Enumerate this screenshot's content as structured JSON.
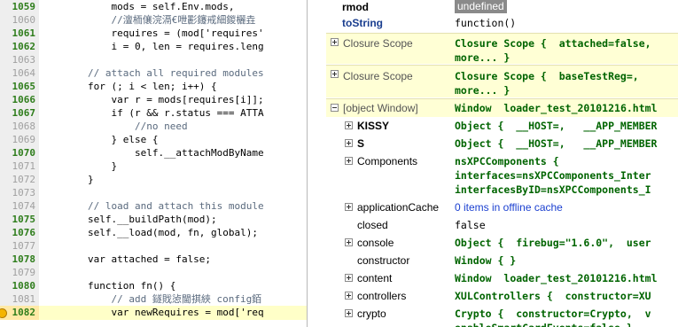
{
  "source": {
    "lines": [
      {
        "num": "1059",
        "exec": true,
        "text": "            mods = self.Env.mods,",
        "comment": false
      },
      {
        "num": "1060",
        "exec": false,
        "text": "            //澶栭儴浣滆€呭彲鑳戒細鍐欐垚",
        "comment": true
      },
      {
        "num": "1061",
        "exec": true,
        "text": "            requires = (mod['requires'",
        "comment": false
      },
      {
        "num": "1062",
        "exec": true,
        "text": "            i = 0, len = requires.leng",
        "comment": false
      },
      {
        "num": "1063",
        "exec": false,
        "text": "",
        "comment": false
      },
      {
        "num": "1064",
        "exec": false,
        "text": "        // attach all required modules",
        "comment": true
      },
      {
        "num": "1065",
        "exec": true,
        "text": "        for (; i < len; i++) {",
        "comment": false
      },
      {
        "num": "1066",
        "exec": true,
        "text": "            var r = mods[requires[i]];",
        "comment": false
      },
      {
        "num": "1067",
        "exec": true,
        "text": "            if (r && r.status === ATTA",
        "comment": false
      },
      {
        "num": "1068",
        "exec": false,
        "text": "                //no need",
        "comment": true
      },
      {
        "num": "1069",
        "exec": false,
        "text": "            } else {",
        "comment": false
      },
      {
        "num": "1070",
        "exec": true,
        "text": "                self.__attachModByName",
        "comment": false
      },
      {
        "num": "1071",
        "exec": false,
        "text": "            }",
        "comment": false
      },
      {
        "num": "1072",
        "exec": false,
        "text": "        }",
        "comment": false
      },
      {
        "num": "1073",
        "exec": false,
        "text": "",
        "comment": false
      },
      {
        "num": "1074",
        "exec": false,
        "text": "        // load and attach this module",
        "comment": true
      },
      {
        "num": "1075",
        "exec": true,
        "text": "        self.__buildPath(mod);",
        "comment": false
      },
      {
        "num": "1076",
        "exec": true,
        "text": "        self.__load(mod, fn, global);",
        "comment": false
      },
      {
        "num": "1077",
        "exec": false,
        "text": "",
        "comment": false
      },
      {
        "num": "1078",
        "exec": true,
        "text": "        var attached = false;",
        "comment": false
      },
      {
        "num": "1079",
        "exec": false,
        "text": "",
        "comment": false
      },
      {
        "num": "1080",
        "exec": true,
        "text": "        function fn() {",
        "comment": false
      },
      {
        "num": "1081",
        "exec": false,
        "text": "            // add 鐩戝惉閫掑綊 config銆",
        "comment": true
      },
      {
        "num": "1082",
        "exec": true,
        "text": "            var newRequires = mod['req",
        "comment": false,
        "current": true
      }
    ]
  },
  "watch": {
    "rmod": {
      "name": "rmod",
      "value": "undefined"
    },
    "toString": {
      "name": "toString",
      "value": "function()"
    },
    "closure1": {
      "label": "Closure Scope",
      "line1": "Closure Scope {  attached=false,",
      "line2": "more... }"
    },
    "closure2": {
      "label": "Closure Scope",
      "line1": "Closure Scope {  baseTestReg=,",
      "line2": "more... }"
    },
    "window": {
      "label": "[object Window]",
      "type": "Window",
      "file": "loader_test_20101216.html"
    },
    "props": [
      {
        "name": "KISSY",
        "style": "bold",
        "twisty": true,
        "value": "Object {  __HOST=,   __APP_MEMBER",
        "kind": "obj"
      },
      {
        "name": "S",
        "style": "bold",
        "twisty": true,
        "value": "Object {  __HOST=,   __APP_MEMBER",
        "kind": "obj"
      },
      {
        "name": "Components",
        "style": "normal",
        "twisty": true,
        "value": "nsXPCComponents {",
        "kind": "obj",
        "extra": [
          "interfaces=nsXPCComponents_Inter",
          "interfacesByID=nsXPCComponents_I"
        ]
      },
      {
        "name": "applicationCache",
        "style": "normal",
        "twisty": true,
        "value": "0 items in offline cache",
        "kind": "link"
      },
      {
        "name": "closed",
        "style": "normal",
        "twisty": false,
        "value": "false",
        "kind": "num"
      },
      {
        "name": "console",
        "style": "normal",
        "twisty": true,
        "value": "Object {  firebug=",
        "kind": "obj",
        "str": "\"1.6.0\"",
        "tail": ",  user"
      },
      {
        "name": "constructor",
        "style": "normal",
        "twisty": false,
        "value": "Window { }",
        "kind": "obj"
      },
      {
        "name": "content",
        "style": "normal",
        "twisty": true,
        "value": "Window",
        "kind": "obj",
        "file": "loader_test_20101216.html"
      },
      {
        "name": "controllers",
        "style": "normal",
        "twisty": true,
        "value": "XULControllers {  constructor=XU",
        "kind": "obj"
      },
      {
        "name": "crypto",
        "style": "normal",
        "twisty": true,
        "value": "Crypto {  constructor=Crypto,  v",
        "kind": "obj",
        "extra": [
          "enableSmartCardEvents=false }"
        ]
      }
    ]
  }
}
